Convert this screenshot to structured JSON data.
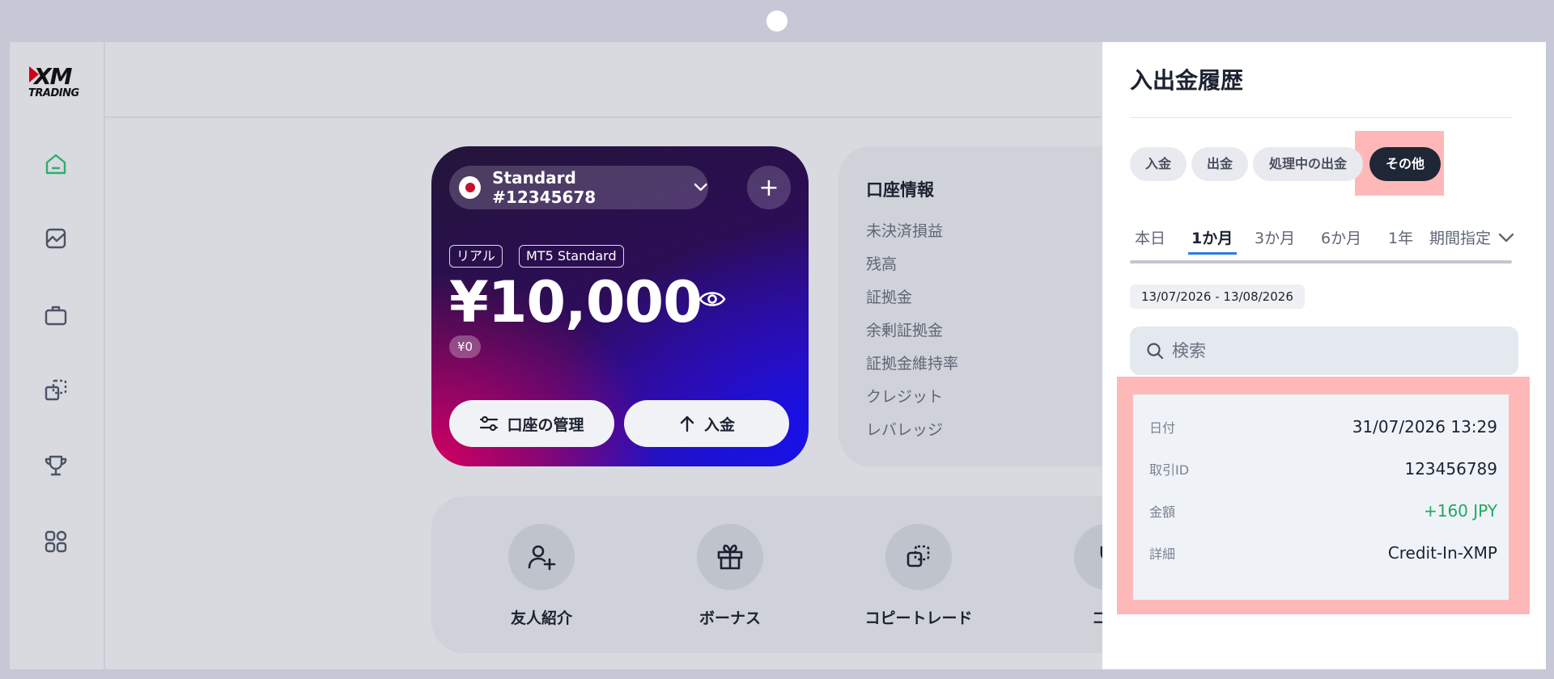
{
  "sidebar": {
    "logo_text": "XM",
    "logo_subtext": "TRADING",
    "items": [
      {
        "icon": "home-icon"
      },
      {
        "icon": "chart-icon"
      },
      {
        "icon": "briefcase-icon"
      },
      {
        "icon": "copy-icon"
      },
      {
        "icon": "trophy-icon"
      },
      {
        "icon": "apps-icon"
      }
    ]
  },
  "account_card": {
    "account_name": "Standard #12345678",
    "tags": [
      "リアル",
      "MT5 Standard"
    ],
    "balance": "¥10,000",
    "sub_balance": "¥0",
    "manage_button": "口座の管理",
    "deposit_button": "入金",
    "plus_label": "+"
  },
  "account_info": {
    "title": "口座情報",
    "rows": [
      "未決済損益",
      "残高",
      "証拠金",
      "余剰証拠金",
      "証拠金維持率",
      "クレジット",
      "レバレッジ"
    ]
  },
  "shortcuts": [
    {
      "label": "友人紹介",
      "icon": "add-user-icon"
    },
    {
      "label": "ボーナス",
      "icon": "gift-icon"
    },
    {
      "label": "コピートレード",
      "icon": "copy-trade-icon"
    },
    {
      "label": "コン",
      "icon": "trophy-icon"
    }
  ],
  "history_panel": {
    "title": "入出金履歴",
    "chips": [
      "入金",
      "出金",
      "処理中の出金",
      "その他"
    ],
    "active_chip": "その他",
    "periods": [
      "本日",
      "1か月",
      "3か月",
      "6か月",
      "1年",
      "期間指定"
    ],
    "active_period": "1か月",
    "date_range": "13/07/2026 - 13/08/2026",
    "search_placeholder": "検索",
    "detail": {
      "date_label": "日付",
      "date_value": "31/07/2026 13:29",
      "txid_label": "取引ID",
      "txid_value": "123456789",
      "amount_label": "金額",
      "amount_value": "+160 JPY",
      "details_label": "詳細",
      "details_value": "Credit-In-XMP"
    }
  },
  "colors": {
    "highlight": "#ffb8b8",
    "active_chip": "#1f2636",
    "positive_amount": "#22a860",
    "active_underline": "#2a7de1"
  }
}
